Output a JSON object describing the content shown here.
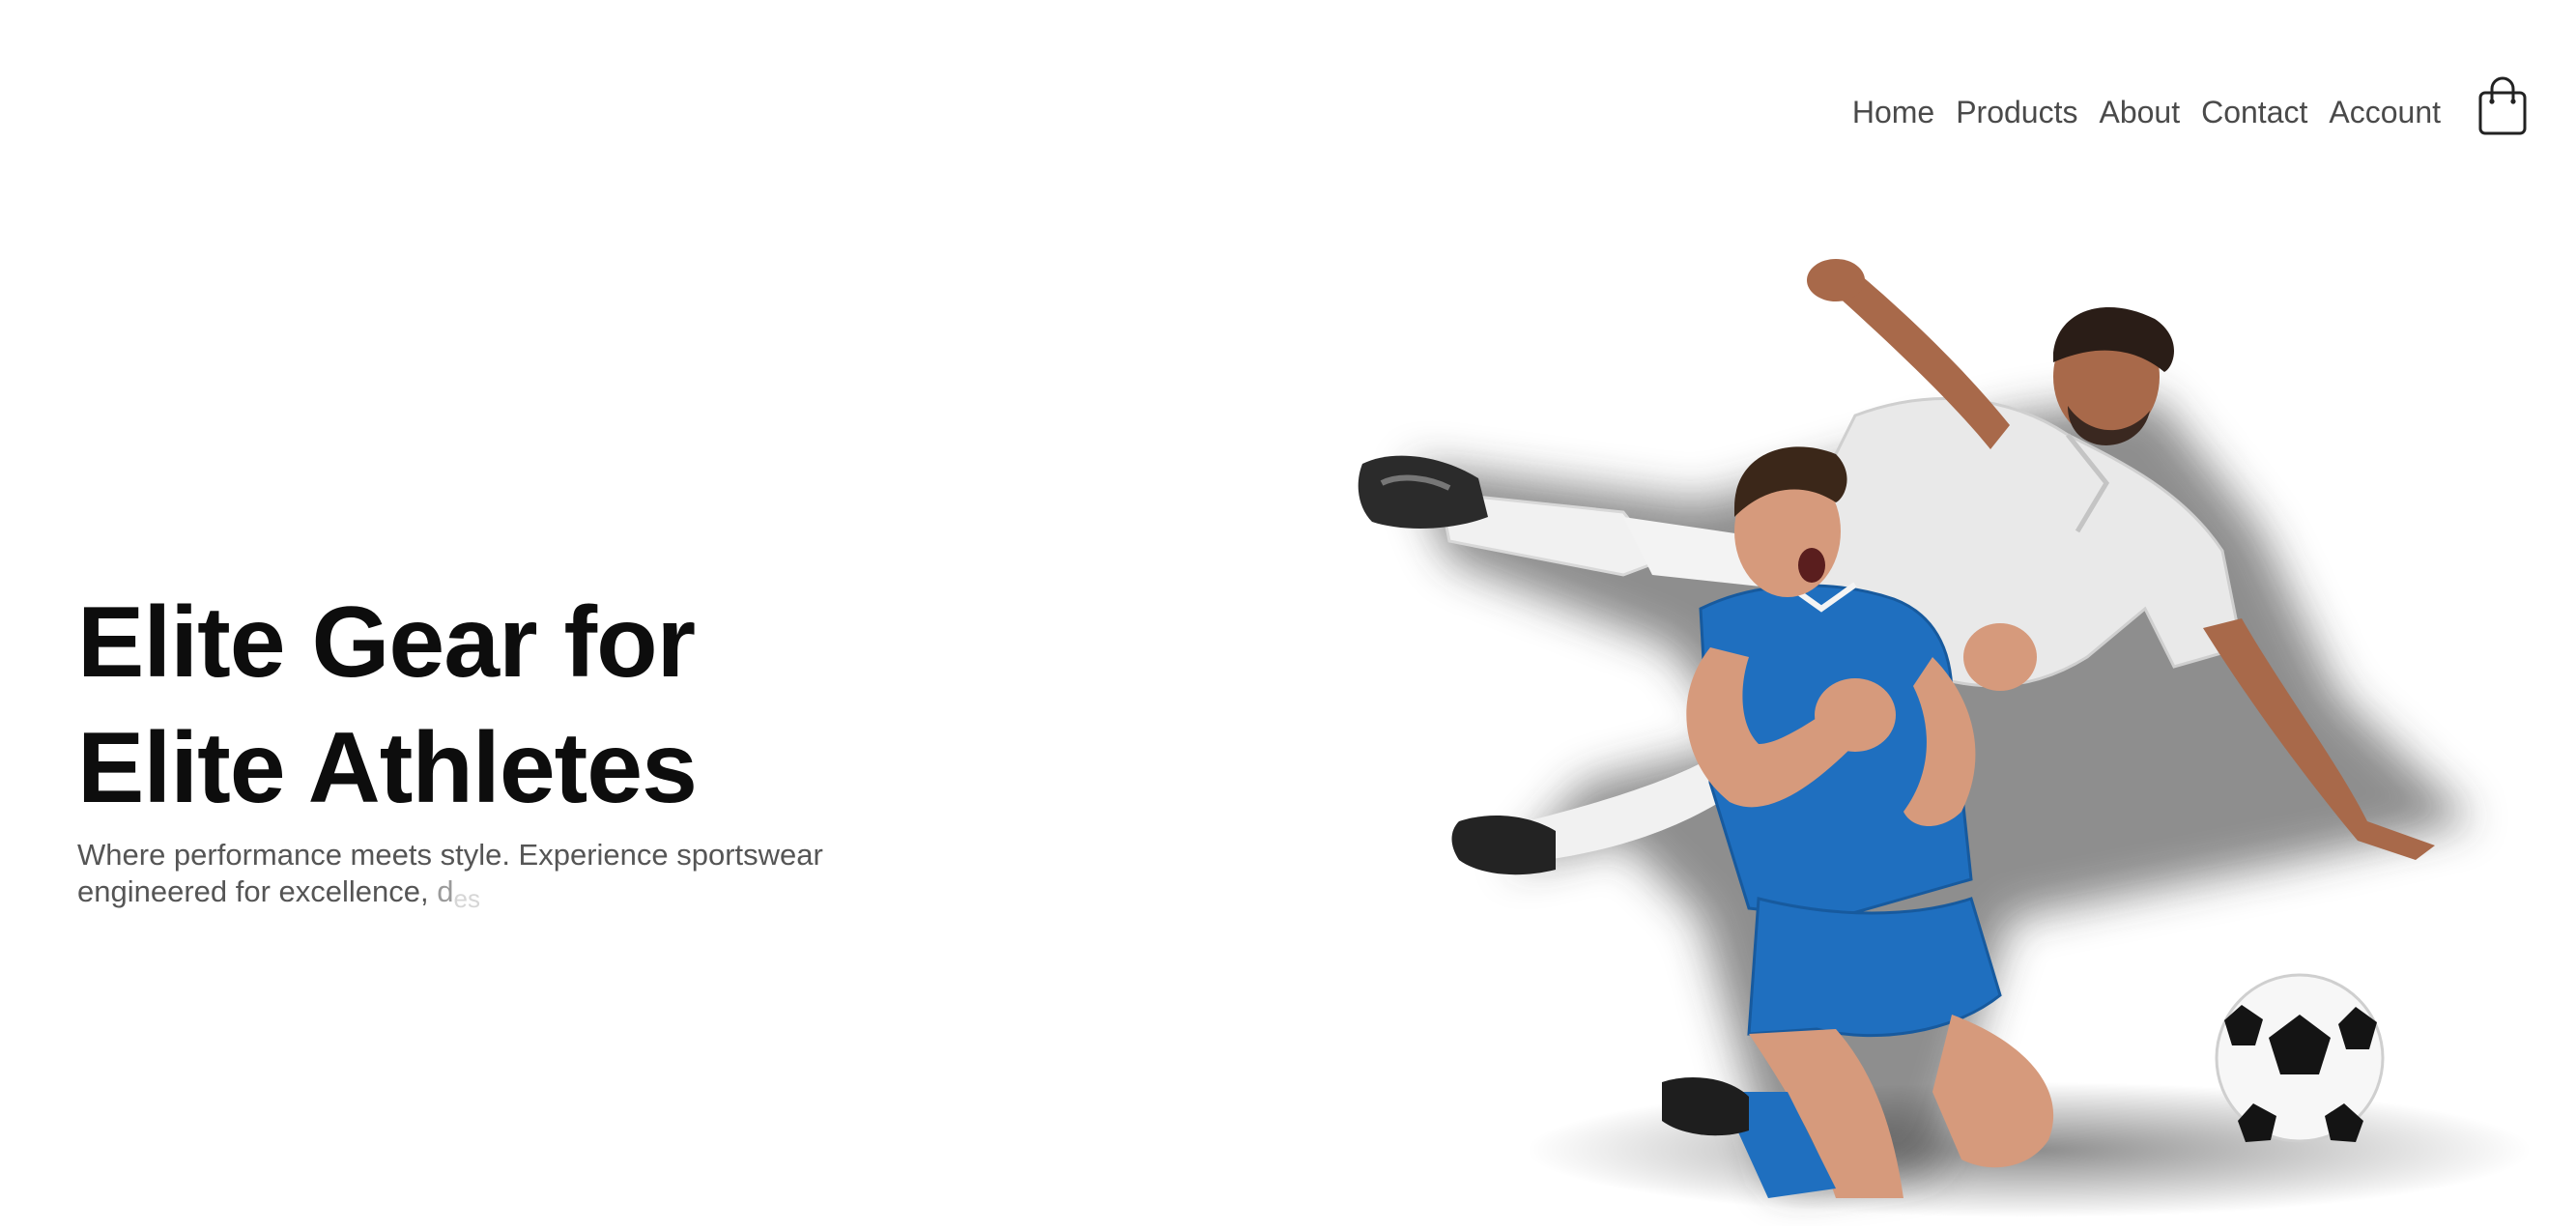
{
  "nav": {
    "items": [
      {
        "label": "Home"
      },
      {
        "label": "Products"
      },
      {
        "label": "About"
      },
      {
        "label": "Contact"
      },
      {
        "label": "Account"
      }
    ],
    "cart_icon": "shopping-bag-icon"
  },
  "hero": {
    "title_line1": "Elite Gear for",
    "title_line2": "Elite Athletes",
    "subtitle_main": "Where performance meets style. Experience sportswear engineered for excellence,",
    "subtitle_fade1": "d",
    "subtitle_fade2": "es",
    "image": "soccer-players-illustration",
    "colors": {
      "kit_blue": "#1f6fbf",
      "kit_white": "#e6e6e6"
    }
  }
}
